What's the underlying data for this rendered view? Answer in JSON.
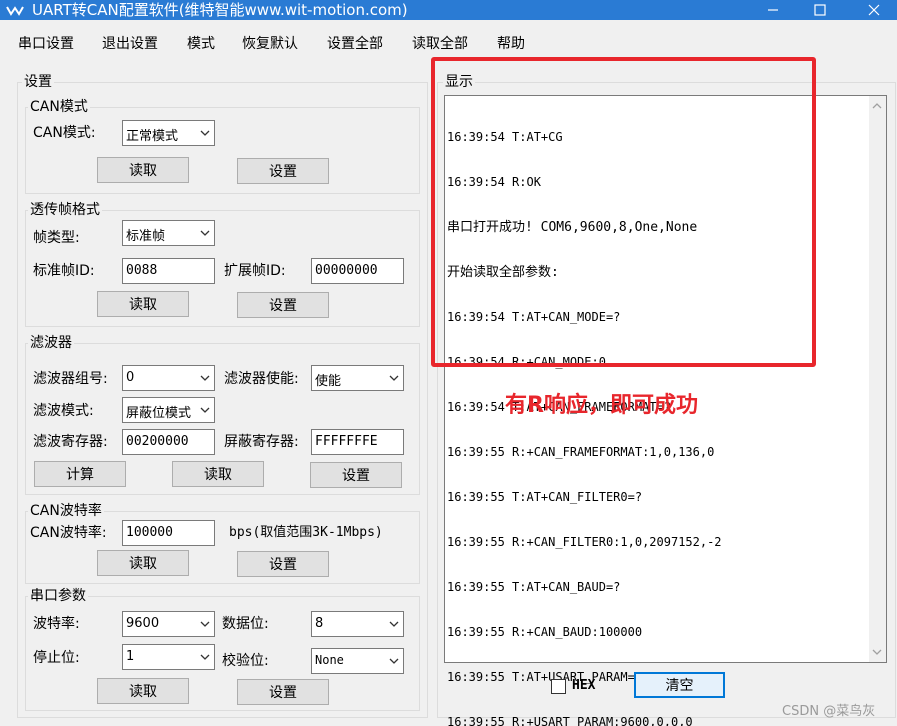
{
  "window": {
    "title": "UART转CAN配置软件(维特智能www.wit-motion.com)"
  },
  "menu": [
    "串口设置",
    "退出设置",
    "模式",
    "恢复默认",
    "设置全部",
    "读取全部",
    "帮助"
  ],
  "settings": {
    "title": "设置",
    "can_mode": {
      "title": "CAN模式",
      "label": "CAN模式:",
      "value": "正常模式",
      "read": "读取",
      "set": "设置"
    },
    "frame_format": {
      "title": "透传帧格式",
      "type_label": "帧类型:",
      "type_value": "标准帧",
      "std_id_label": "标准帧ID:",
      "std_id_value": "0088",
      "ext_id_label": "扩展帧ID:",
      "ext_id_value": "00000000",
      "read": "读取",
      "set": "设置"
    },
    "filter": {
      "title": "滤波器",
      "group_label": "滤波器组号:",
      "group_value": "0",
      "enable_label": "滤波器使能:",
      "enable_value": "使能",
      "mode_label": "滤波模式:",
      "mode_value": "屏蔽位模式",
      "reg_label": "滤波寄存器:",
      "reg_value": "00200000",
      "mask_label": "屏蔽寄存器:",
      "mask_value": "FFFFFFFE",
      "calc": "计算",
      "read": "读取",
      "set": "设置"
    },
    "can_baud": {
      "title": "CAN波特率",
      "label": "CAN波特率:",
      "value": "100000",
      "hint": "bps(取值范围3K-1Mbps)",
      "read": "读取",
      "set": "设置"
    },
    "serial": {
      "title": "串口参数",
      "baud_label": "波特率:",
      "baud_value": "9600",
      "data_bits_label": "数据位:",
      "data_bits_value": "8",
      "stop_bits_label": "停止位:",
      "stop_bits_value": "1",
      "parity_label": "校验位:",
      "parity_value": "None",
      "read": "读取",
      "set": "设置"
    }
  },
  "display": {
    "title": "显示",
    "lines": [
      "16:39:54 T:AT+CG",
      "16:39:54 R:OK",
      "串口打开成功! COM6,9600,8,One,None",
      "开始读取全部参数:",
      "16:39:54 T:AT+CAN_MODE=?",
      "16:39:54 R:+CAN_MODE:0",
      "16:39:54 T:AT+CAN_FRAMEFORMAT=?",
      "16:39:55 R:+CAN_FRAMEFORMAT:1,0,136,0",
      "16:39:55 T:AT+CAN_FILTER0=?",
      "16:39:55 R:+CAN_FILTER0:1,0,2097152,-2",
      "16:39:55 T:AT+CAN_BAUD=?",
      "16:39:55 R:+CAN_BAUD:100000",
      "16:39:55 T:AT+USART_PARAM=?",
      "16:39:55 R:+USART_PARAM:9600,0,0,0"
    ],
    "hex_label": "HEX",
    "clear": "清空"
  },
  "annotation": "有R响应，即可成功",
  "watermark": "CSDN @菜鸟灰",
  "colors": {
    "titlebar": "#2a7bd4",
    "highlight": "#e8262c",
    "button_focus": "#0078d7"
  }
}
